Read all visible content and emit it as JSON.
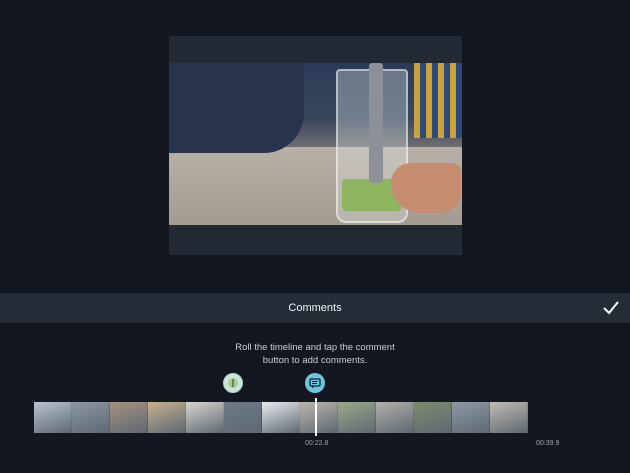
{
  "header": {
    "title": "Comments",
    "done_icon": "checkmark-icon"
  },
  "hint": {
    "line1": "Roll the timeline and tap the comment",
    "line2": "button to add comments."
  },
  "markers": [
    {
      "icon": "thumbnail-marker-icon"
    },
    {
      "icon": "comment-icon"
    }
  ],
  "timeline": {
    "current_time": "00:22.8",
    "end_time": "00:39.9",
    "frames": [
      "#b9c4d1",
      "#8d96a3",
      "#a5927f",
      "#c7b28f",
      "#d8d5cf",
      "#6d7a86",
      "#e9ecef",
      "#bcb6aa",
      "#9da88a",
      "#b3b0aa",
      "#7e8b6f",
      "#8e99a5",
      "#c1bcb3",
      "#e7e9ec",
      "#a9a59c",
      "#b8c4d6",
      "#6e7b89",
      "#c3c7ca",
      "#8fa27a",
      "#d0cdc7"
    ]
  },
  "colors": {
    "accent": "#6cc7de",
    "background": "#131820",
    "bar": "#252c36"
  }
}
